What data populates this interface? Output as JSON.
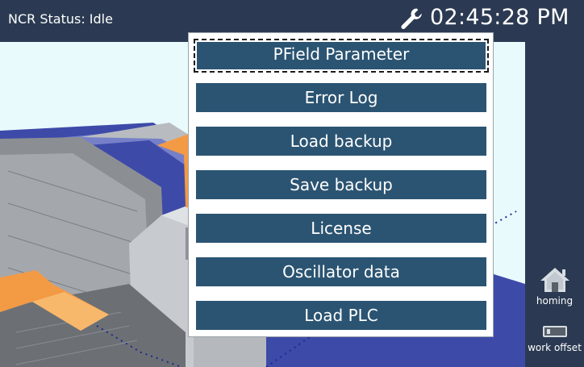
{
  "status_bar": {
    "ncr_status": "NCR Status: Idle",
    "clock": "02:45:28 PM",
    "settings_icon": "wrench-icon"
  },
  "menu": {
    "items": [
      {
        "label": "PField Parameter",
        "focused": true
      },
      {
        "label": "Error Log"
      },
      {
        "label": "Load backup"
      },
      {
        "label": "Save backup"
      },
      {
        "label": "License"
      },
      {
        "label": "Oscillator data"
      },
      {
        "label": "Load PLC"
      }
    ]
  },
  "side_panel": {
    "homing": {
      "label": "homing",
      "icon": "home-icon"
    },
    "work_offset": {
      "label": "work offset",
      "icon": "toggle-icon"
    }
  },
  "colors": {
    "bar_background": "#2b3a52",
    "menu_button": "#2b5472",
    "viewport_background": "#e8fafc",
    "arrow_orange": "#f39a45"
  }
}
